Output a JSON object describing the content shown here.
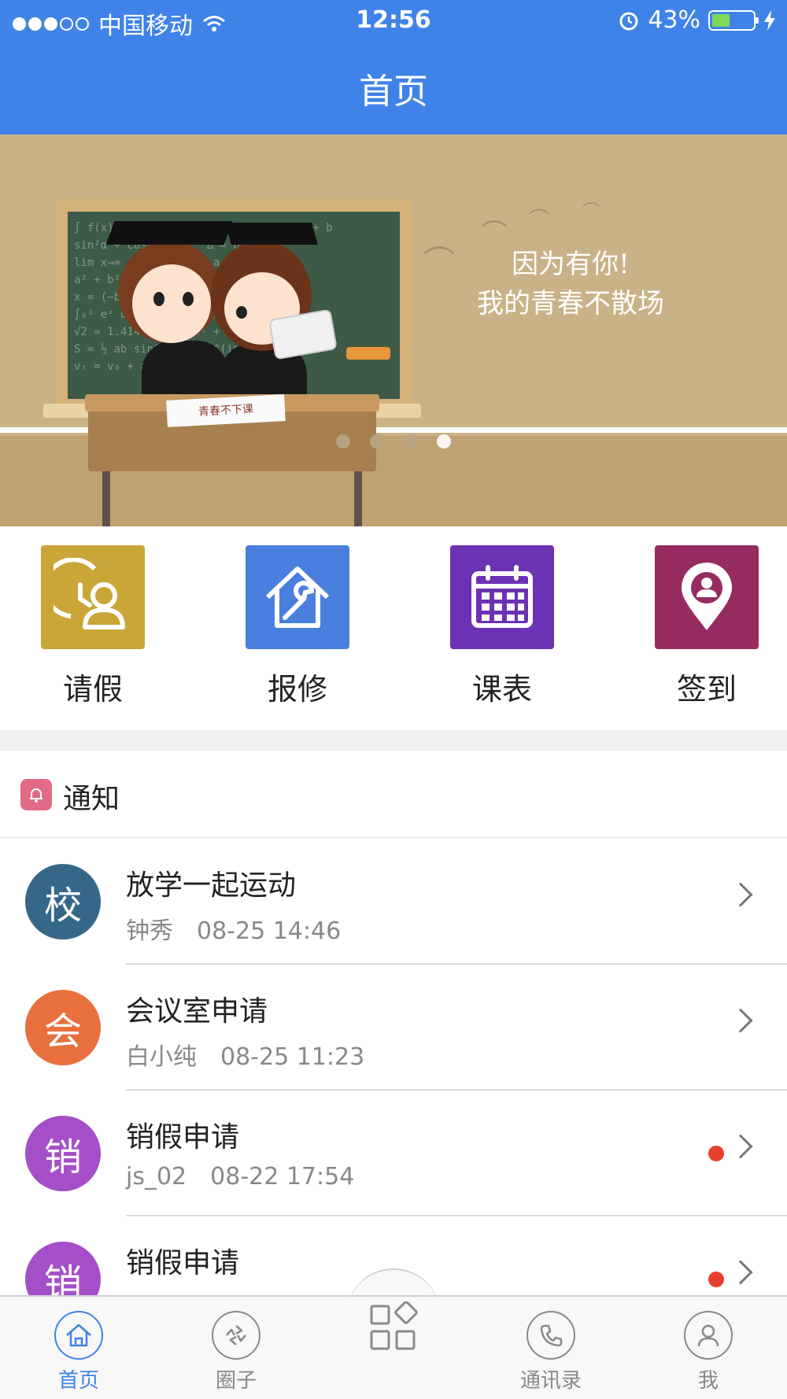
{
  "status_bar": {
    "carrier": "中国移动",
    "time": "12:56",
    "battery_percent": "43%",
    "battery_level": 0.43,
    "signal_bars": 3,
    "signal_total": 5
  },
  "header": {
    "title": "首页"
  },
  "banner": {
    "line1": "因为有你!",
    "line2": "我的青春不散场",
    "paper_text": "青春不下课",
    "page_count": 4,
    "active_page": 4
  },
  "quick_actions": [
    {
      "label": "请假",
      "icon": "leave-clock-person-icon",
      "color": "#c9a637"
    },
    {
      "label": "报修",
      "icon": "house-wrench-icon",
      "color": "#4a7fdf"
    },
    {
      "label": "课表",
      "icon": "calendar-icon",
      "color": "#6b32b4"
    },
    {
      "label": "签到",
      "icon": "location-pin-icon",
      "color": "#962b62"
    }
  ],
  "notice_section": {
    "title": "通知",
    "icon": "bell-icon",
    "icon_color": "#e36a86"
  },
  "notices": [
    {
      "avatar": "校",
      "avatar_color": "#366788",
      "title": "放学一起运动",
      "author": "钟秀",
      "time": "08-25 14:46",
      "unread": false
    },
    {
      "avatar": "会",
      "avatar_color": "#e8703f",
      "title": "会议室申请",
      "author": "白小纯",
      "time": "08-25 11:23",
      "unread": false
    },
    {
      "avatar": "销",
      "avatar_color": "#a44fc8",
      "title": "销假申请",
      "author": "js_02",
      "time": "08-22 17:54",
      "unread": true
    },
    {
      "avatar": "销",
      "avatar_color": "#a44fc8",
      "title": "销假申请",
      "author": "",
      "time": "",
      "unread": true
    }
  ],
  "tabbar": {
    "items": [
      {
        "label": "首页",
        "icon": "home-icon",
        "active": true
      },
      {
        "label": "圈子",
        "icon": "aperture-icon",
        "active": false
      },
      {
        "label": "",
        "icon": "app-grid-icon",
        "active": false
      },
      {
        "label": "通讯录",
        "icon": "phone-icon",
        "active": false
      },
      {
        "label": "我",
        "icon": "person-icon",
        "active": false
      }
    ],
    "active_color": "#3f83e8"
  },
  "colors": {
    "primary": "#3f83e8",
    "unread_dot": "#e8402f"
  }
}
